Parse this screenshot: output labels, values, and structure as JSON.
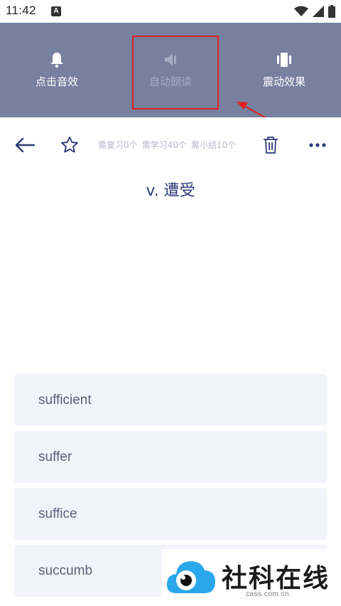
{
  "status_bar": {
    "time": "11:42",
    "notification_icon": "A"
  },
  "settings": [
    {
      "label": "点击音效",
      "icon": "bell-icon",
      "state": "on"
    },
    {
      "label": "自动朗读",
      "icon": "speaker-icon",
      "state": "off"
    },
    {
      "label": "震动效果",
      "icon": "vibrate-icon",
      "state": "on"
    }
  ],
  "toolbar": {
    "counts": {
      "review": "需复习0个",
      "learn": "需学习40个",
      "summary": "需小结10个"
    }
  },
  "question": {
    "definition": "v. 遭受"
  },
  "options": [
    "sufficient",
    "suffer",
    "suffice",
    "succumb"
  ],
  "watermark": {
    "title": "社科在线",
    "url": "cass.com.cn"
  },
  "colors": {
    "panel": "#7880a0",
    "accent": "#2f3a78",
    "highlight": "#e02020"
  }
}
